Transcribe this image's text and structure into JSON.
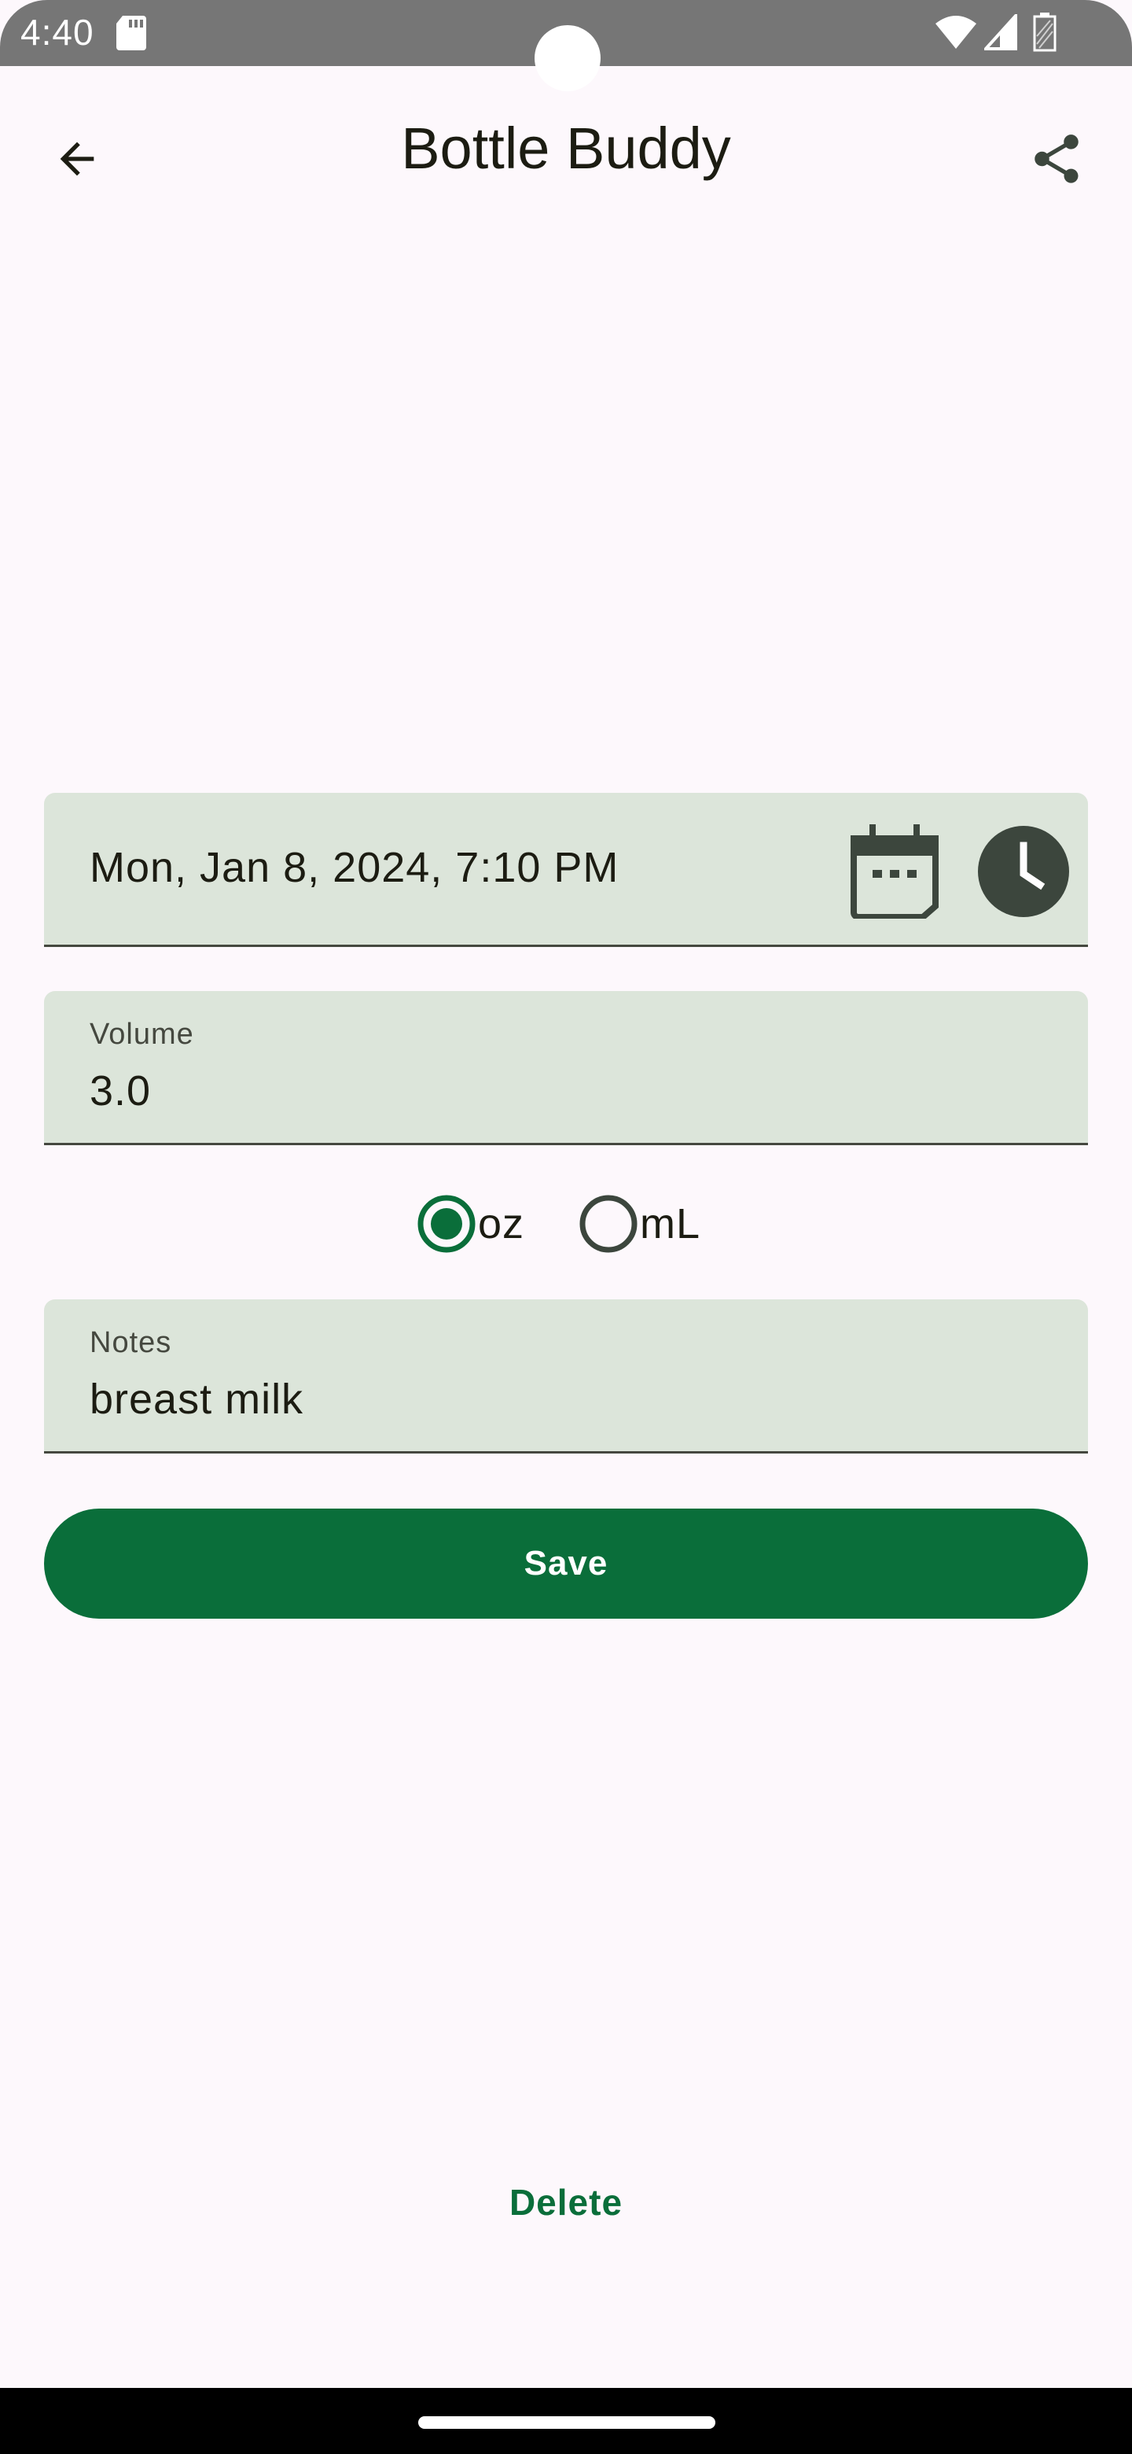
{
  "status_bar": {
    "time": "4:40",
    "icons": [
      "sd-card-icon",
      "wifi-icon",
      "signal-icon",
      "battery-icon"
    ]
  },
  "app_bar": {
    "title": "Bottle Buddy",
    "back_icon": "arrow-back-icon",
    "share_icon": "share-icon"
  },
  "form": {
    "datetime": "Mon, Jan 8, 2024, 7:10 PM",
    "volume_label": "Volume",
    "volume_value": "3.0",
    "units": [
      {
        "label": "oz",
        "selected": true
      },
      {
        "label": "mL",
        "selected": false
      }
    ],
    "notes_label": "Notes",
    "notes_value": "breast milk",
    "save_label": "Save",
    "delete_label": "Delete"
  },
  "colors": {
    "background": "#fdf8fc",
    "field_background": "#dce5da",
    "primary": "#0a6e3a",
    "icon_dark": "#3c463d",
    "status_bar": "#767676"
  }
}
